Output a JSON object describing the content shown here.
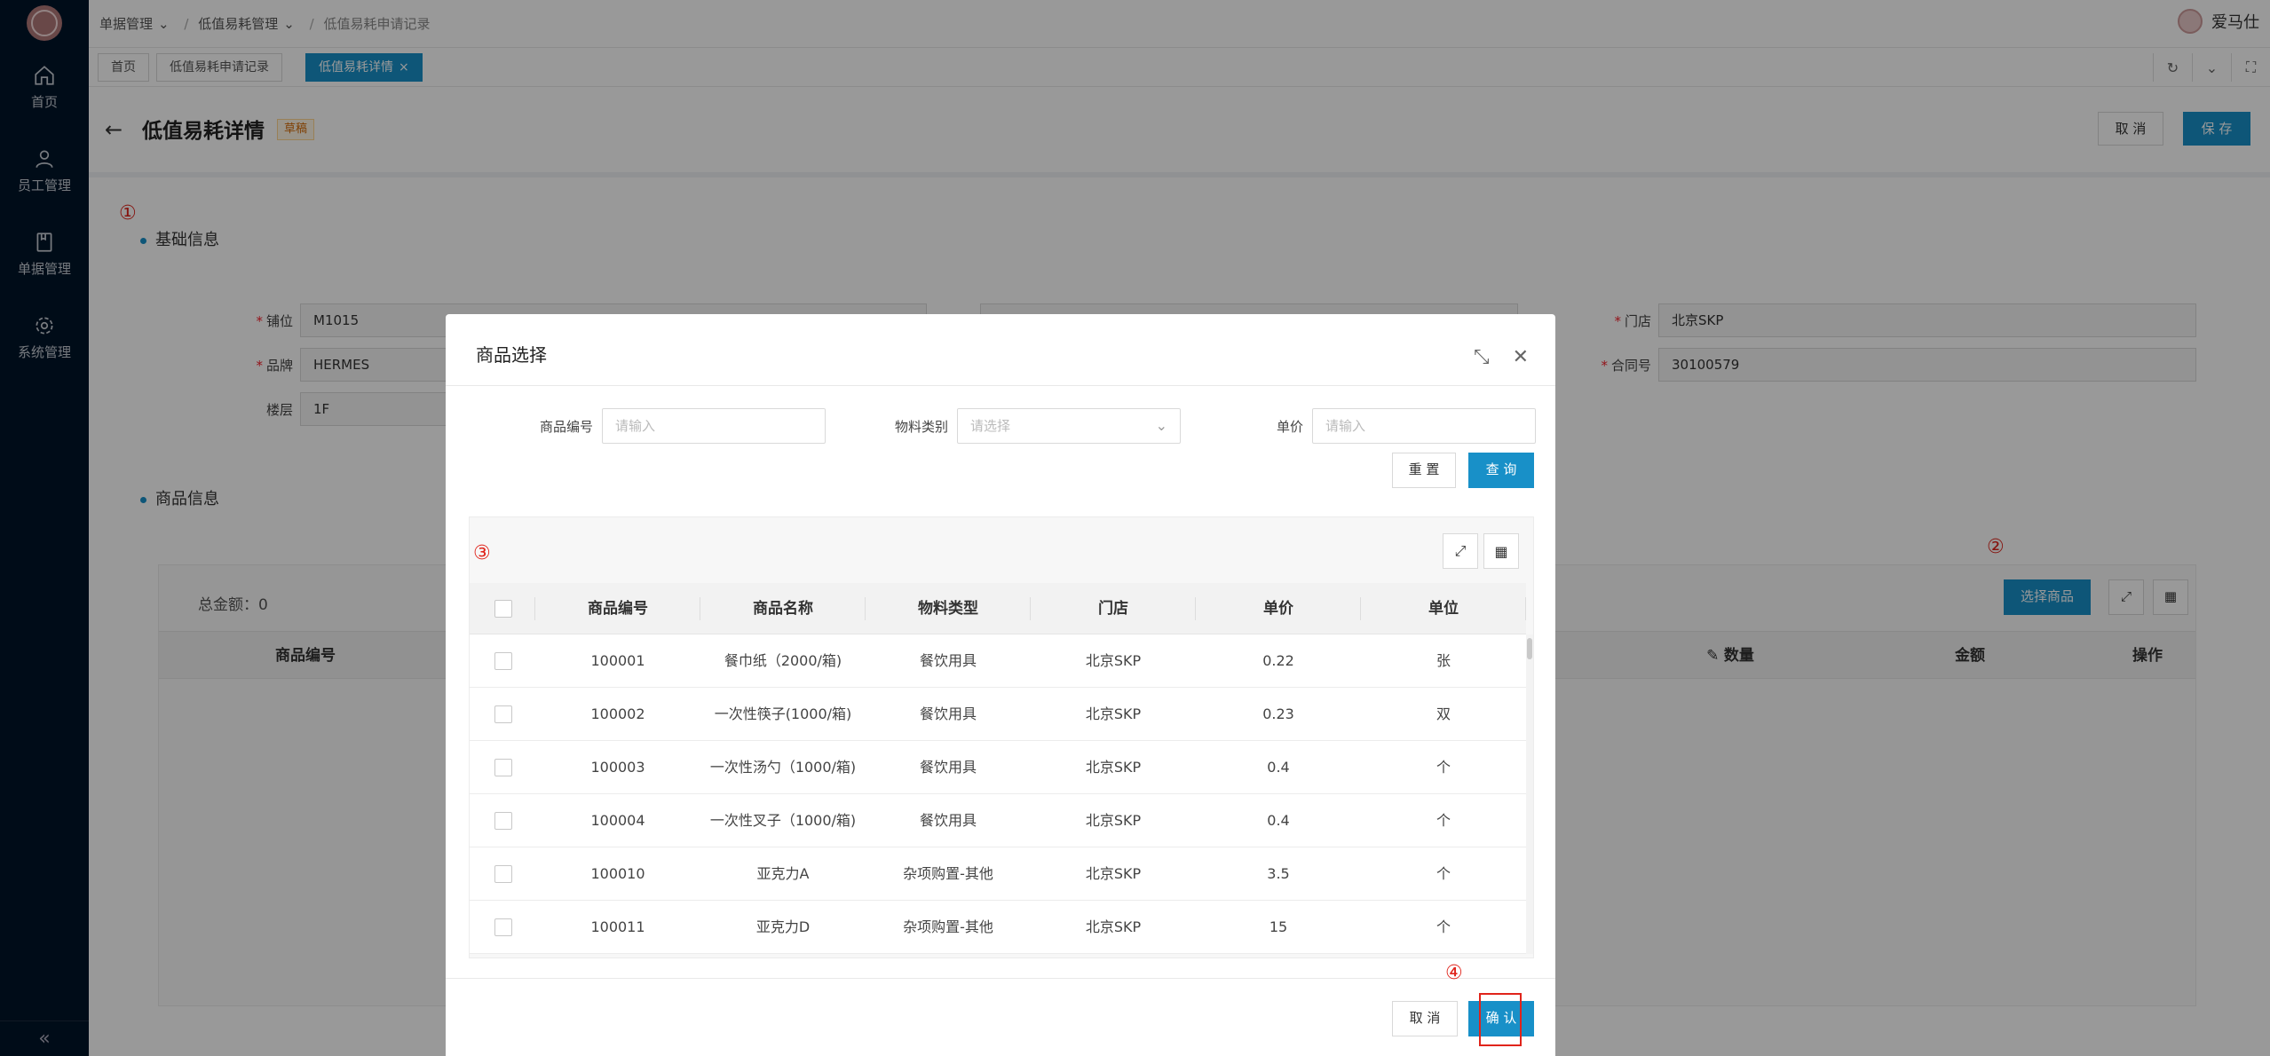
{
  "sidebar": {
    "items": [
      {
        "label": "首页",
        "icon": "home-icon"
      },
      {
        "label": "员工管理",
        "icon": "user-icon"
      },
      {
        "label": "单据管理",
        "icon": "document-icon"
      },
      {
        "label": "系统管理",
        "icon": "gear-icon"
      }
    ],
    "collapse": "«"
  },
  "header": {
    "breadcrumb": [
      "单据管理",
      "低值易耗管理",
      "低值易耗申请记录"
    ],
    "user": "爱马仕"
  },
  "tabs": [
    {
      "label": "首页"
    },
    {
      "label": "低值易耗申请记录"
    },
    {
      "label": "低值易耗详情",
      "close": "×"
    }
  ],
  "page": {
    "title": "低值易耗详情",
    "status_badge": "草稿",
    "cancel_label": "取 消",
    "save_label": "保 存"
  },
  "basic": {
    "section_title": "基础信息",
    "fields": {
      "slot_label": "铺位",
      "slot_value": "M1015",
      "brand_label": "品牌",
      "brand_value": "HERMES",
      "floor_label": "楼层",
      "floor_value": "1F",
      "store_label": "门店",
      "store_value": "北京SKP",
      "contract_label": "合同号",
      "contract_value": "30100579"
    }
  },
  "goods": {
    "section_title": "商品信息",
    "total": "总金额：0",
    "select_button": "选择商品",
    "columns": [
      "商品编号",
      "数量",
      "金额",
      "操作"
    ]
  },
  "annotations": [
    "①",
    "②",
    "③",
    "④"
  ],
  "modal": {
    "title": "商品选择",
    "query": {
      "code_label": "商品编号",
      "code_placeholder": "请输入",
      "type_label": "物料类别",
      "type_placeholder": "请选择",
      "price_label": "单价",
      "price_placeholder": "请输入",
      "reset_label": "重 置",
      "search_label": "查 询"
    },
    "columns": [
      "商品编号",
      "商品名称",
      "物料类型",
      "门店",
      "单价",
      "单位"
    ],
    "rows": [
      {
        "code": "100001",
        "name": "餐巾纸（2000/箱)",
        "type": "餐饮用具",
        "store": "北京SKP",
        "price": "0.22",
        "unit": "张"
      },
      {
        "code": "100002",
        "name": "一次性筷子(1000/箱)",
        "type": "餐饮用具",
        "store": "北京SKP",
        "price": "0.23",
        "unit": "双"
      },
      {
        "code": "100003",
        "name": "一次性汤勺（1000/箱)",
        "type": "餐饮用具",
        "store": "北京SKP",
        "price": "0.4",
        "unit": "个"
      },
      {
        "code": "100004",
        "name": "一次性叉子（1000/箱)",
        "type": "餐饮用具",
        "store": "北京SKP",
        "price": "0.4",
        "unit": "个"
      },
      {
        "code": "100010",
        "name": "亚克力A",
        "type": "杂项购置-其他",
        "store": "北京SKP",
        "price": "3.5",
        "unit": "个"
      },
      {
        "code": "100011",
        "name": "亚克力D",
        "type": "杂项购置-其他",
        "store": "北京SKP",
        "price": "15",
        "unit": "个"
      }
    ],
    "cancel_label": "取 消",
    "confirm_label": "确 认"
  },
  "colors": {
    "primary": "#1890c8",
    "sidebar": "#001529",
    "annotation": "#e0241b"
  }
}
